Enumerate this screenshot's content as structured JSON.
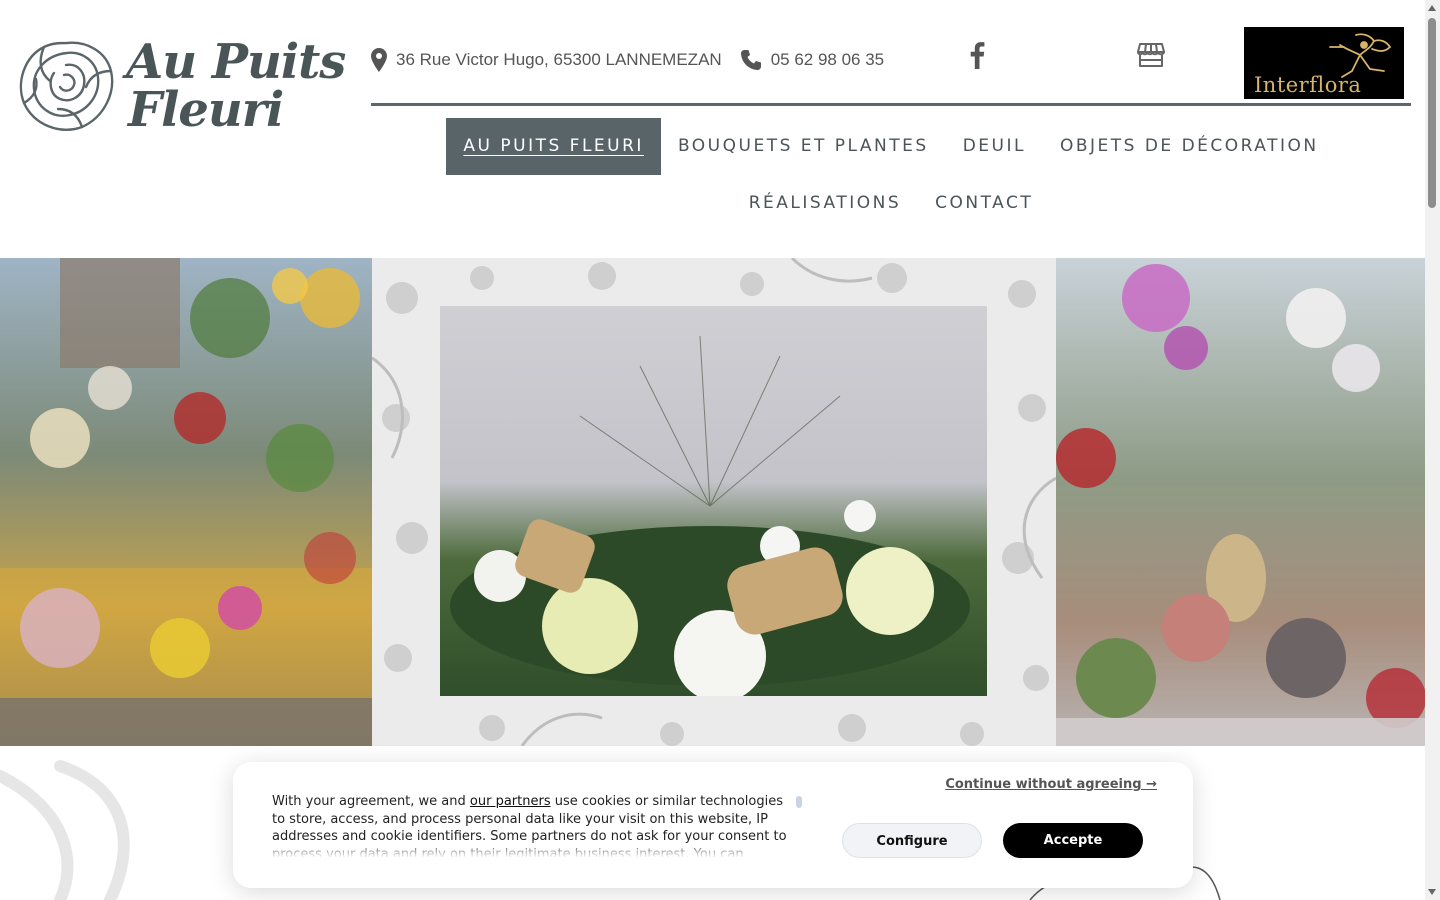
{
  "brand": {
    "logo_lines": [
      "Au Puits",
      "Fleuri"
    ],
    "logo_icon": "rose-icon"
  },
  "contact": {
    "address": "36 Rue Victor Hugo, 65300 LANNEMEZAN",
    "address_icon": "map-pin-icon",
    "phone": "05 62 98 06 35",
    "phone_icon": "phone-icon",
    "facebook_icon": "facebook-icon",
    "store_icon": "storefront-icon"
  },
  "partner": {
    "name": "Interflora"
  },
  "nav": {
    "items": [
      {
        "label": "AU PUITS FLEURI",
        "active": true
      },
      {
        "label": "BOUQUETS ET PLANTES"
      },
      {
        "label": "DEUIL"
      },
      {
        "label": "OBJETS DE DÉCORATION"
      },
      {
        "label": "RÉALISATIONS"
      },
      {
        "label": "CONTACT"
      }
    ]
  },
  "cookie_banner": {
    "text_before_link": "With your agreement, we and ",
    "partners_link": "our partners",
    "text_after_link": " use cookies or similar technologies to store, access, and process personal data like your visit on this website, IP addresses and cookie identifiers. Some partners do not ask for your consent to process your data and rely on their legitimate business interest. You can",
    "continue_label": "Continue without agreeing →",
    "configure_label": "Configure",
    "accept_label": "Accepte"
  },
  "colors": {
    "nav_active_bg": "#596468",
    "logo_text": "#4a5558",
    "interflora_bg": "#000000",
    "interflora_text": "#d8b46a"
  }
}
